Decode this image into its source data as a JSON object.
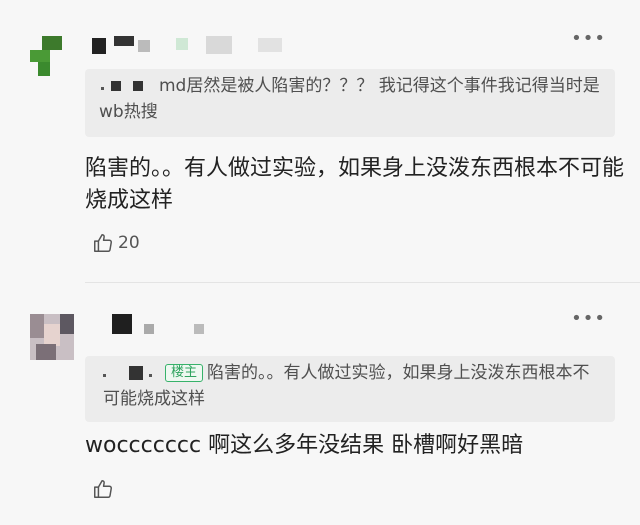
{
  "comments": [
    {
      "quote_prefix": "md居然是被人陷害的？？？ 我记得这个事件我记得当时是wb热搜",
      "body": "陷害的。。有人做过实验，如果身上没泼东西根本不可能烧成这样",
      "likes": "20",
      "more": "•••"
    },
    {
      "host_badge": "楼主",
      "quote_text": "陷害的。。有人做过实验，如果身上没泼东西根本不可能烧成这样",
      "body": "woccccccc 啊这么多年没结果 卧槽啊好黑暗",
      "likes": "",
      "more": "•••"
    }
  ],
  "colors": {
    "page_bg": "#f7f7f7",
    "quote_bg": "#ececec",
    "host_badge": "#37b26a"
  }
}
